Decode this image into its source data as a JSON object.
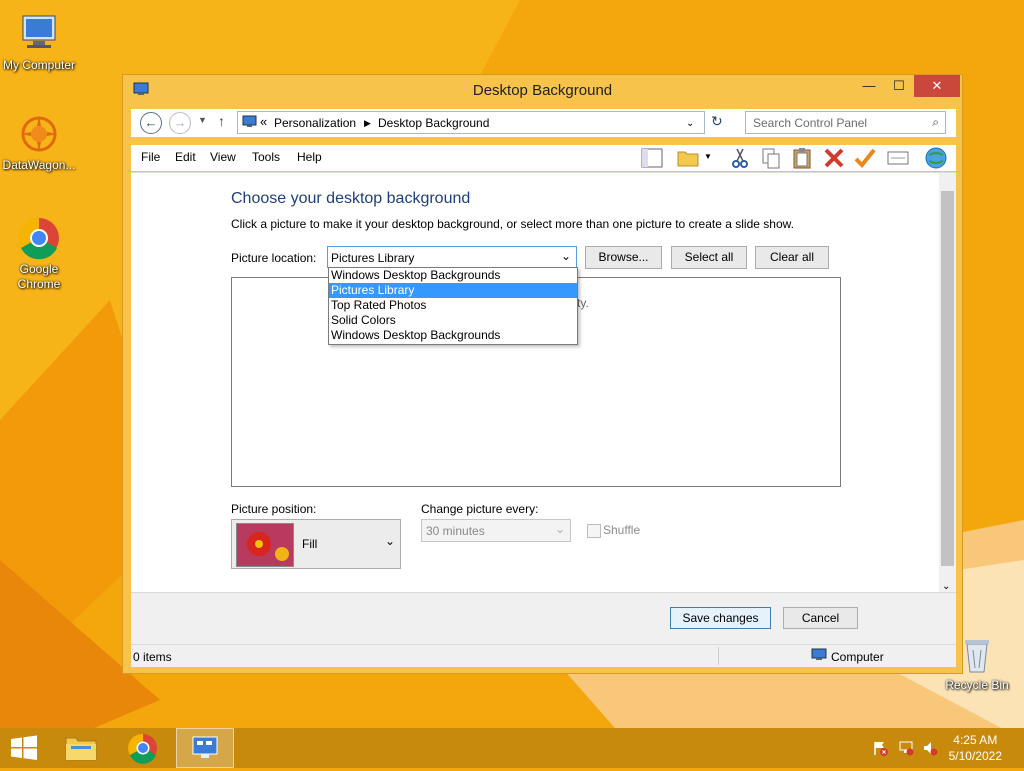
{
  "desktop": {
    "icons": [
      {
        "label": "My Computer",
        "icon": "computer-icon"
      },
      {
        "label": "DataWagon...",
        "icon": "datawagon-icon"
      },
      {
        "label": "Google Chrome",
        "icon": "chrome-icon"
      },
      {
        "label": "Recycle Bin",
        "icon": "recycle-bin-icon"
      }
    ]
  },
  "window": {
    "title": "Desktop Background",
    "controls": {
      "minimize": "—",
      "maximize": "☐",
      "close": "✕"
    },
    "address": {
      "separator": "«",
      "crumbs": [
        "Personalization",
        "Desktop Background"
      ],
      "search_placeholder": "Search Control Panel"
    },
    "menu": [
      "File",
      "Edit",
      "View",
      "Tools",
      "Help"
    ],
    "toolbar_icons": [
      "layout-icon",
      "folder-icon",
      "cut-icon",
      "copy-icon",
      "paste-icon",
      "delete-icon",
      "check-icon",
      "properties-icon",
      "globe-icon"
    ]
  },
  "main": {
    "heading": "Choose your desktop background",
    "subtext": "Click a picture to make it your desktop background, or select more than one picture to create a slide show.",
    "picture_location": {
      "label": "Picture location:",
      "selected": "Pictures Library",
      "options": [
        "Windows Desktop Backgrounds",
        "Pictures Library",
        "Top Rated Photos",
        "Solid Colors",
        "Windows Desktop Backgrounds"
      ]
    },
    "buttons": {
      "browse": "Browse...",
      "select_all": "Select all",
      "clear_all": "Clear all"
    },
    "picture_area_tail": "ty.",
    "picture_position": {
      "label": "Picture position:",
      "value": "Fill"
    },
    "change_every": {
      "label": "Change picture every:",
      "value": "30 minutes"
    },
    "shuffle": "Shuffle"
  },
  "footer": {
    "save": "Save changes",
    "cancel": "Cancel"
  },
  "status": {
    "items": "0 items",
    "location": "Computer"
  },
  "taskbar": {
    "time": "4:25 AM",
    "date": "5/10/2022"
  },
  "colors": {
    "accent": "#3399ff",
    "heading": "#1e3f7a",
    "desktop": "#f4a70c"
  }
}
